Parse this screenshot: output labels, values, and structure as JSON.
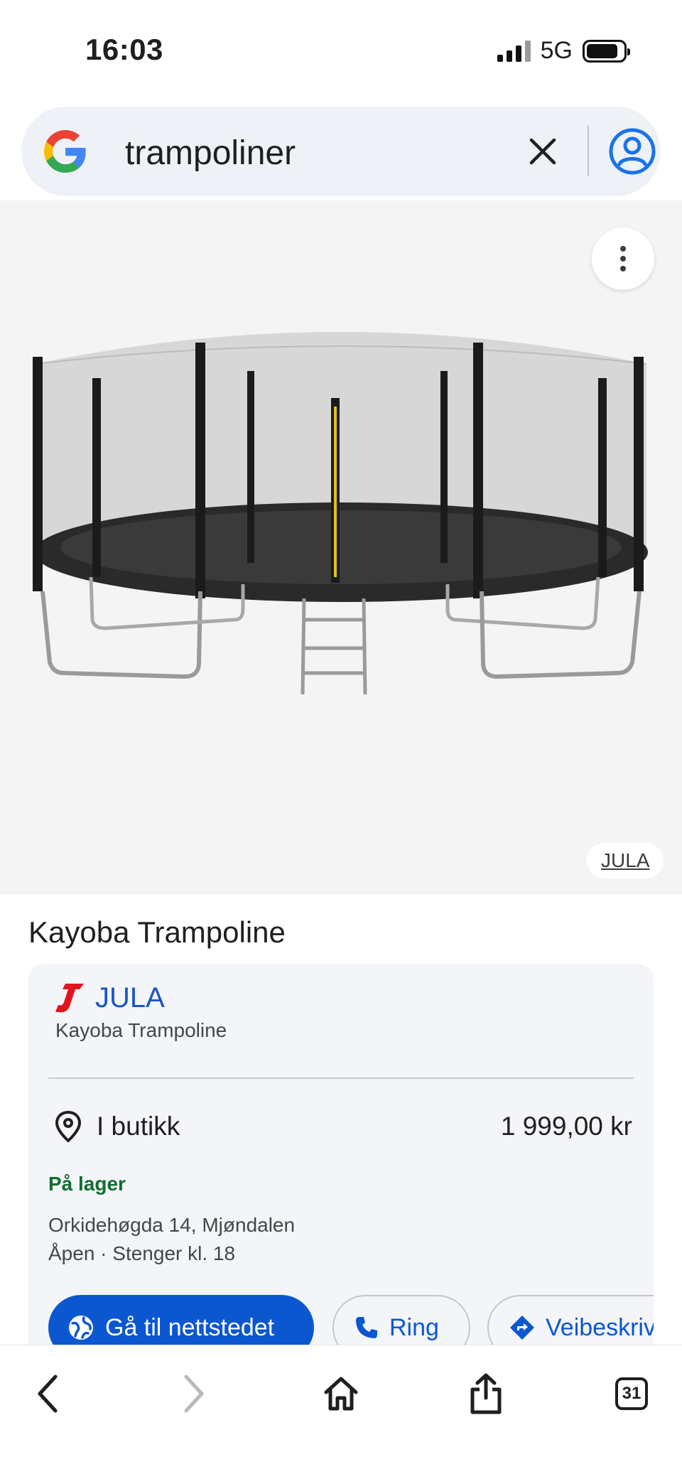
{
  "status_bar": {
    "time": "16:03",
    "network": "5G",
    "signal_bars": 4,
    "battery_level": 0.85
  },
  "search": {
    "query": "trampoliner",
    "logo_icon": "google-g-icon",
    "clear_icon": "close-icon",
    "account_icon": "account-circle-icon"
  },
  "image": {
    "menu_icon": "more-vert-icon",
    "source": "JULA"
  },
  "product": {
    "title": "Kayoba Trampoline"
  },
  "offer": {
    "merchant": "JULA",
    "merchant_subtitle": "Kayoba Trampoline",
    "store_label": "I butikk",
    "price": "1 999,00 kr",
    "stock": "På lager",
    "address": "Orkidehøgda 14, Mjøndalen",
    "hours": "Åpen · Stenger kl. 18",
    "buttons": {
      "website": "Gå til nettstedet",
      "call": "Ring",
      "directions": "Veibeskriv"
    },
    "accent_color": "#0b57d0",
    "stock_color": "#146c2e"
  },
  "toolbar": {
    "tab_count": "31"
  }
}
